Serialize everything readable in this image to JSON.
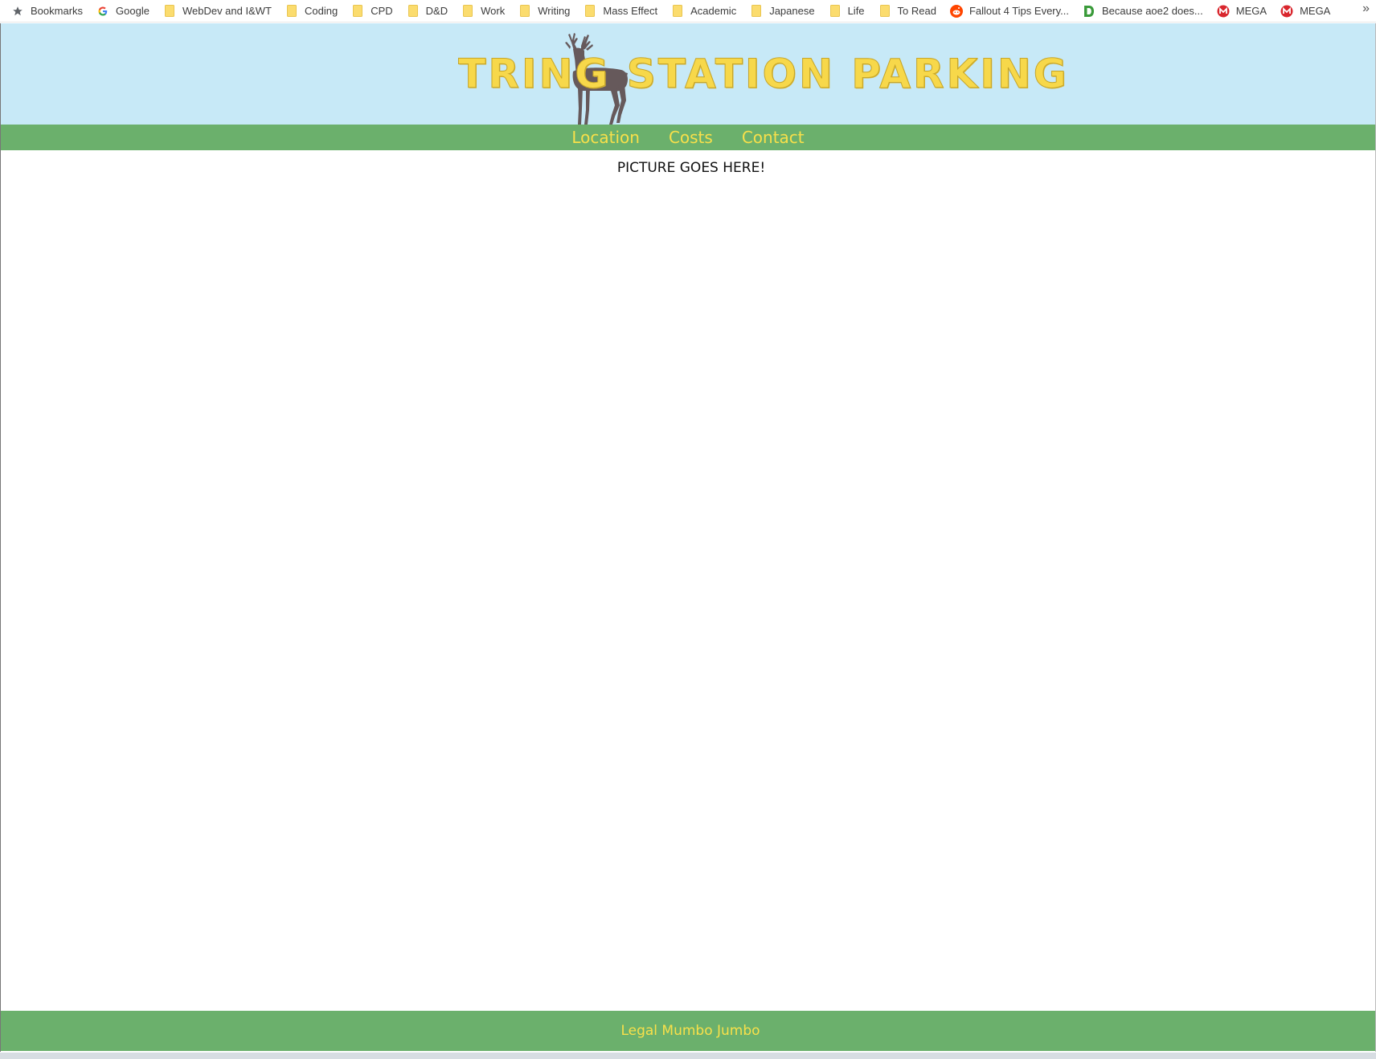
{
  "bookmarks_bar": {
    "items": [
      {
        "label": "Bookmarks",
        "icon": "star-icon"
      },
      {
        "label": "Google",
        "icon": "google-icon"
      },
      {
        "label": "WebDev and I&WT",
        "icon": "folder-icon"
      },
      {
        "label": "Coding",
        "icon": "folder-icon"
      },
      {
        "label": "CPD",
        "icon": "folder-icon"
      },
      {
        "label": "D&D",
        "icon": "folder-icon"
      },
      {
        "label": "Work",
        "icon": "folder-icon"
      },
      {
        "label": "Writing",
        "icon": "folder-icon"
      },
      {
        "label": "Mass Effect",
        "icon": "folder-icon"
      },
      {
        "label": "Academic",
        "icon": "folder-icon"
      },
      {
        "label": "Japanese",
        "icon": "folder-icon"
      },
      {
        "label": "Life",
        "icon": "folder-icon"
      },
      {
        "label": "To Read",
        "icon": "folder-icon"
      },
      {
        "label": "Fallout 4 Tips Every...",
        "icon": "reddit-icon"
      },
      {
        "label": "Because aoe2 does...",
        "icon": "d-logo-icon"
      },
      {
        "label": "MEGA",
        "icon": "mega-icon"
      },
      {
        "label": "MEGA",
        "icon": "mega-icon"
      }
    ],
    "overflow_glyph": "»"
  },
  "header": {
    "title": "TRING STATION PARKING",
    "logo": "deer-icon"
  },
  "nav": {
    "location": "Location",
    "costs": "Costs",
    "contact": "Contact"
  },
  "main": {
    "placeholder": "PICTURE GOES HERE!"
  },
  "footer": {
    "text": "Legal Mumbo Jumbo"
  },
  "colors": {
    "header_bg": "#c7e9f7",
    "nav_bg": "#6bb06c",
    "accent_yellow": "#f8e04a",
    "deer": "#66595b"
  }
}
